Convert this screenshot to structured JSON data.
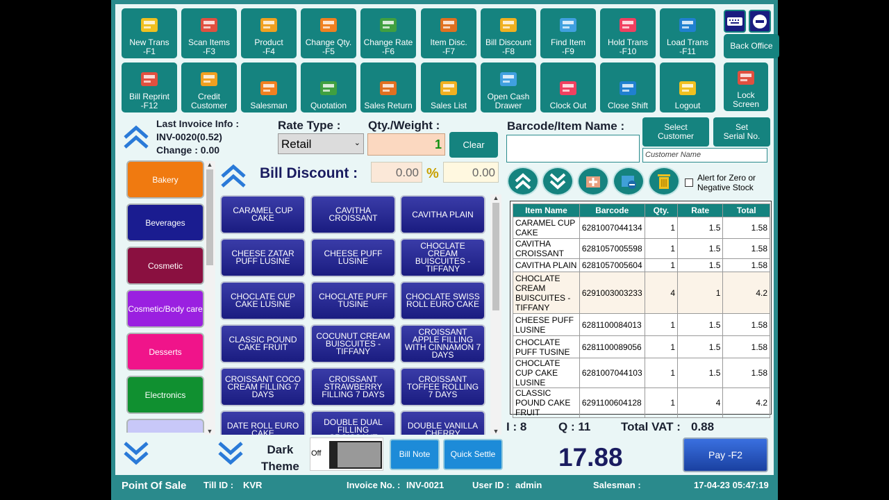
{
  "toolbar": [
    {
      "label": "New Trans\n-F1",
      "icon": "cash-register-icon"
    },
    {
      "label": "Scan Items\n-F3",
      "icon": "barcode-icon"
    },
    {
      "label": "Product\n-F4",
      "icon": "product-box-icon"
    },
    {
      "label": "Change Qty.\n-F5",
      "icon": "box-icon"
    },
    {
      "label": "Change Rate\n-F6",
      "icon": "rate-chart-icon"
    },
    {
      "label": "Item Disc.\n-F7",
      "icon": "gift-box-icon"
    },
    {
      "label": "Bill Discount\n-F8",
      "icon": "price-tag-icon"
    },
    {
      "label": "Find Item\n-F9",
      "icon": "magnifier-icon"
    },
    {
      "label": "Hold Trans\n-F10",
      "icon": "mobile-cart-icon"
    },
    {
      "label": "Load Trans\n-F11",
      "icon": "monitor-icon"
    },
    {
      "label": "Back Office",
      "icon": ""
    },
    {
      "label": "Bill Reprint\n-F12",
      "icon": "printer-icon"
    },
    {
      "label": "Credit\nCustomer",
      "icon": "customers-icon"
    },
    {
      "label": "Salesman",
      "icon": "salesman-icon"
    },
    {
      "label": "Quotation",
      "icon": "document-icon"
    },
    {
      "label": "Sales Return",
      "icon": "report-icon"
    },
    {
      "label": "Sales List",
      "icon": "list-screen-icon"
    },
    {
      "label": "Open Cash\nDrawer",
      "icon": "cash-drawer-icon"
    },
    {
      "label": "Clock Out",
      "icon": "calendar-clock-icon"
    },
    {
      "label": "Close Shift",
      "icon": "calculator-icon"
    },
    {
      "label": "Logout",
      "icon": "door-icon"
    },
    {
      "label": "Lock\nScreen",
      "icon": "lock-icon"
    }
  ],
  "last_invoice": {
    "title": "Last Invoice Info :",
    "invoice": "INV-0020(0.52)",
    "change": "Change : 0.00"
  },
  "rate_type": {
    "label": "Rate Type :",
    "value": "Retail"
  },
  "qty": {
    "label": "Qty./Weight :",
    "value": "1",
    "clear": "Clear"
  },
  "barcode": {
    "label": "Barcode/Item Name :",
    "value": "",
    "select_customer": "Select\nCustomer",
    "set_serial": "Set\nSerial No.",
    "customer_placeholder": "Customer Name"
  },
  "bill_discount": {
    "label": "Bill Discount :",
    "value": "0.00",
    "percent_symbol": "%",
    "percent_value": "0.00"
  },
  "alert": "Alert for Zero or\nNegative Stock",
  "categories": [
    {
      "name": "Bakery",
      "color": "#f07a10"
    },
    {
      "name": "Beverages",
      "color": "#1a1c90"
    },
    {
      "name": "Cosmetic",
      "color": "#8a1040"
    },
    {
      "name": "Cosmetic/Body care",
      "color": "#9a20e0"
    },
    {
      "name": "Desserts",
      "color": "#f0148a"
    },
    {
      "name": "Electronics",
      "color": "#109030"
    },
    {
      "name": "",
      "color": "#c8c8f8"
    }
  ],
  "products": [
    "CARAMEL CUP CAKE",
    "CAVITHA CROISSANT",
    "CAVITHA PLAIN",
    "CHEESE  ZATAR PUFF LUSINE",
    "CHEESE PUFF LUSINE",
    "CHOCLATE CREAM BUISCUITES - TIFFANY",
    "CHOCLATE CUP CAKE LUSINE",
    "CHOCLATE PUFF TUSINE",
    "CHOCLATE SWISS ROLL EURO CAKE",
    "CLASSIC POUND CAKE FRUIT",
    "COCUNUT CREAM BUISCUITES - TIFFANY",
    "CROISSANT APPLE FILLING WITH CINNAMON   7 DAYS",
    "CROISSANT COCO CREAM FILLING  7 DAYS",
    "CROISSANT STRAWBERRY FILLING 7 DAYS",
    "CROISSANT TOFFEE ROLLING 7 DAYS",
    "DATE ROLL EURO CAKE",
    "DOUBLE DUAL FILLING CROISSANT",
    "DOUBLE VANILLA CHERRY"
  ],
  "grid": {
    "headers": [
      "Item Name",
      "Barcode",
      "Qty.",
      "Rate",
      "Total"
    ],
    "rows": [
      [
        "CARAMEL CUP CAKE",
        "6281007044134",
        "1",
        "1.5",
        "1.58"
      ],
      [
        "CAVITHA CROISSANT",
        "6281057005598",
        "1",
        "1.5",
        "1.58"
      ],
      [
        "CAVITHA PLAIN",
        "6281057005604",
        "1",
        "1.5",
        "1.58"
      ],
      [
        "CHOCLATE CREAM BUISCUITES - TIFFANY",
        "6291003003233",
        "4",
        "1",
        "4.2"
      ],
      [
        "CHEESE PUFF LUSINE",
        "6281100084013",
        "1",
        "1.5",
        "1.58"
      ],
      [
        "CHOCLATE PUFF TUSINE",
        "6281100089056",
        "1",
        "1.5",
        "1.58"
      ],
      [
        "CHOCLATE CUP CAKE LUSINE",
        "6281007044103",
        "1",
        "1.5",
        "1.58"
      ],
      [
        "CLASSIC POUND CAKE FRUIT",
        "6291100604128",
        "1",
        "4",
        "4.2"
      ]
    ]
  },
  "totals": {
    "items": "I : 8",
    "qty": "Q :  11",
    "vat_label": "Total VAT :",
    "vat": "0.88",
    "grand": "17.88"
  },
  "bottom": {
    "dark_theme": "Dark\nTheme",
    "toggle": "Off",
    "bill_note": "Bill Note",
    "quick_settle": "Quick Settle",
    "pay": "Pay  -F2"
  },
  "status": {
    "app": "Point Of Sale",
    "till_label": "Till ID :",
    "till": "KVR",
    "invoice_label": "Invoice No. :",
    "invoice": "INV-0021",
    "user_label": "User ID :",
    "user": "admin",
    "salesman_label": "Salesman :",
    "datetime": "17-04-23 05:47:19"
  },
  "colors": {
    "accent": "#15837f",
    "product": "#1a1c80",
    "background": "#eaf6f6"
  }
}
